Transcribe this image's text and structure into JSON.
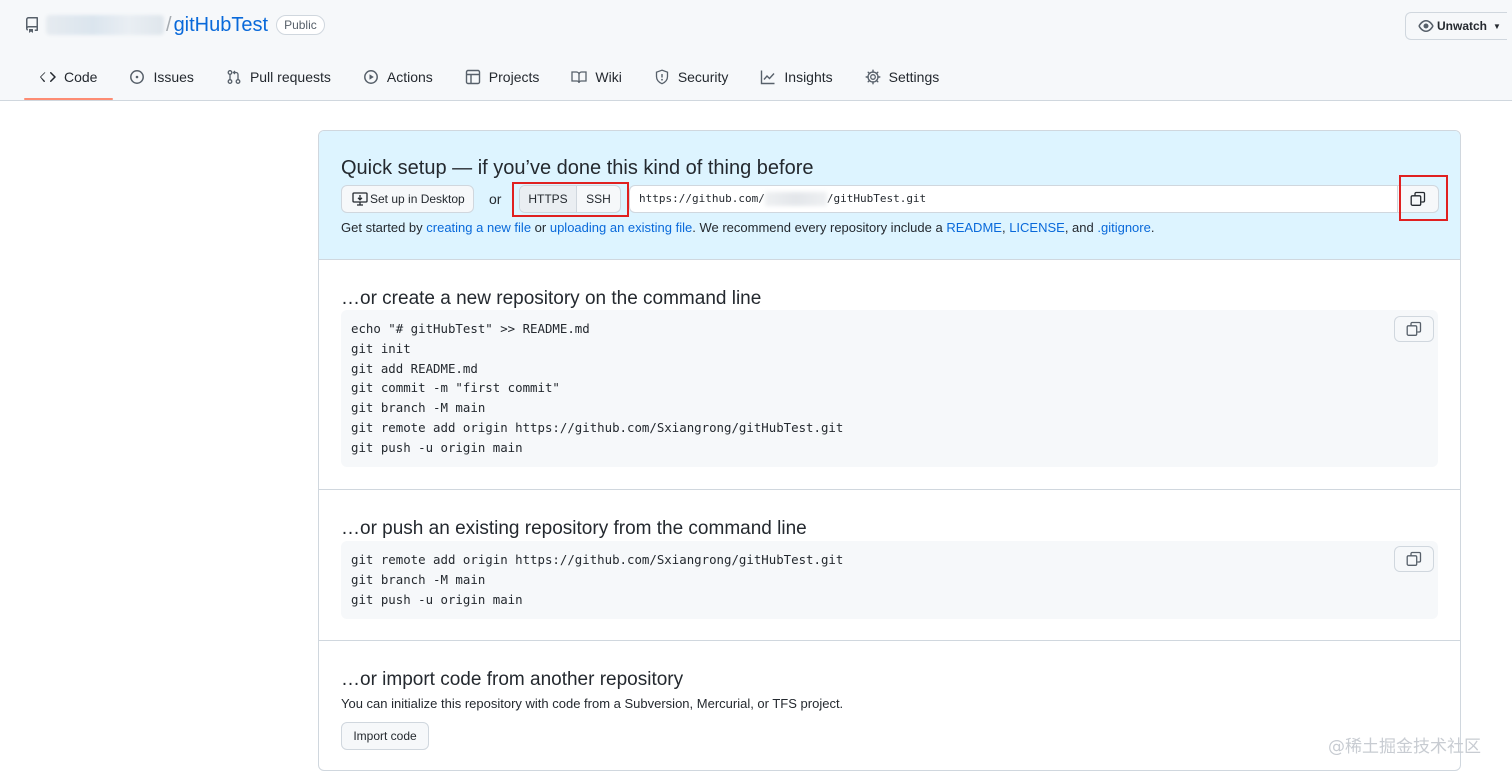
{
  "repo": {
    "name": "gitHubTest",
    "visibility": "Public"
  },
  "header": {
    "watch_label": "Unwatch"
  },
  "nav": [
    {
      "label": "Code",
      "icon": "code-icon"
    },
    {
      "label": "Issues",
      "icon": "issue-icon"
    },
    {
      "label": "Pull requests",
      "icon": "pull-request-icon"
    },
    {
      "label": "Actions",
      "icon": "play-icon"
    },
    {
      "label": "Projects",
      "icon": "table-icon"
    },
    {
      "label": "Wiki",
      "icon": "book-icon"
    },
    {
      "label": "Security",
      "icon": "shield-icon"
    },
    {
      "label": "Insights",
      "icon": "graph-icon"
    },
    {
      "label": "Settings",
      "icon": "gear-icon"
    }
  ],
  "quick_setup": {
    "title": "Quick setup — if you’ve done this kind of thing before",
    "desktop_label": "Set up in Desktop",
    "or": "or",
    "https_label": "HTTPS",
    "ssh_label": "SSH",
    "url_prefix": "https://github.com/",
    "url_suffix": "/gitHubTest.git",
    "help": {
      "t1": "Get started by ",
      "l1": "creating a new file",
      "t2": " or ",
      "l2": "uploading an existing file",
      "t3": ". We recommend every repository include a ",
      "l3": "README",
      "t4": ", ",
      "l4": "LICENSE",
      "t5": ", and ",
      "l5": ".gitignore",
      "t6": "."
    }
  },
  "create_section": {
    "title": "…or create a new repository on the command line",
    "code": [
      "echo \"# gitHubTest\" >> README.md",
      "git init",
      "git add README.md",
      "git commit -m \"first commit\"",
      "git branch -M main",
      "git remote add origin https://github.com/Sxiangrong/gitHubTest.git",
      "git push -u origin main"
    ]
  },
  "push_section": {
    "title": "…or push an existing repository from the command line",
    "code": [
      "git remote add origin https://github.com/Sxiangrong/gitHubTest.git",
      "git branch -M main",
      "git push -u origin main"
    ]
  },
  "import_section": {
    "title": "…or import code from another repository",
    "help": "You can initialize this repository with code from a Subversion, Mercurial, or TFS project.",
    "button_label": "Import code"
  },
  "watermark": "@稀土掘金技术社区",
  "colors": {
    "link": "#0969da",
    "quick_bg": "#ddf4ff",
    "highlight": "#e02020",
    "nav_underline": "#fd8c73"
  }
}
